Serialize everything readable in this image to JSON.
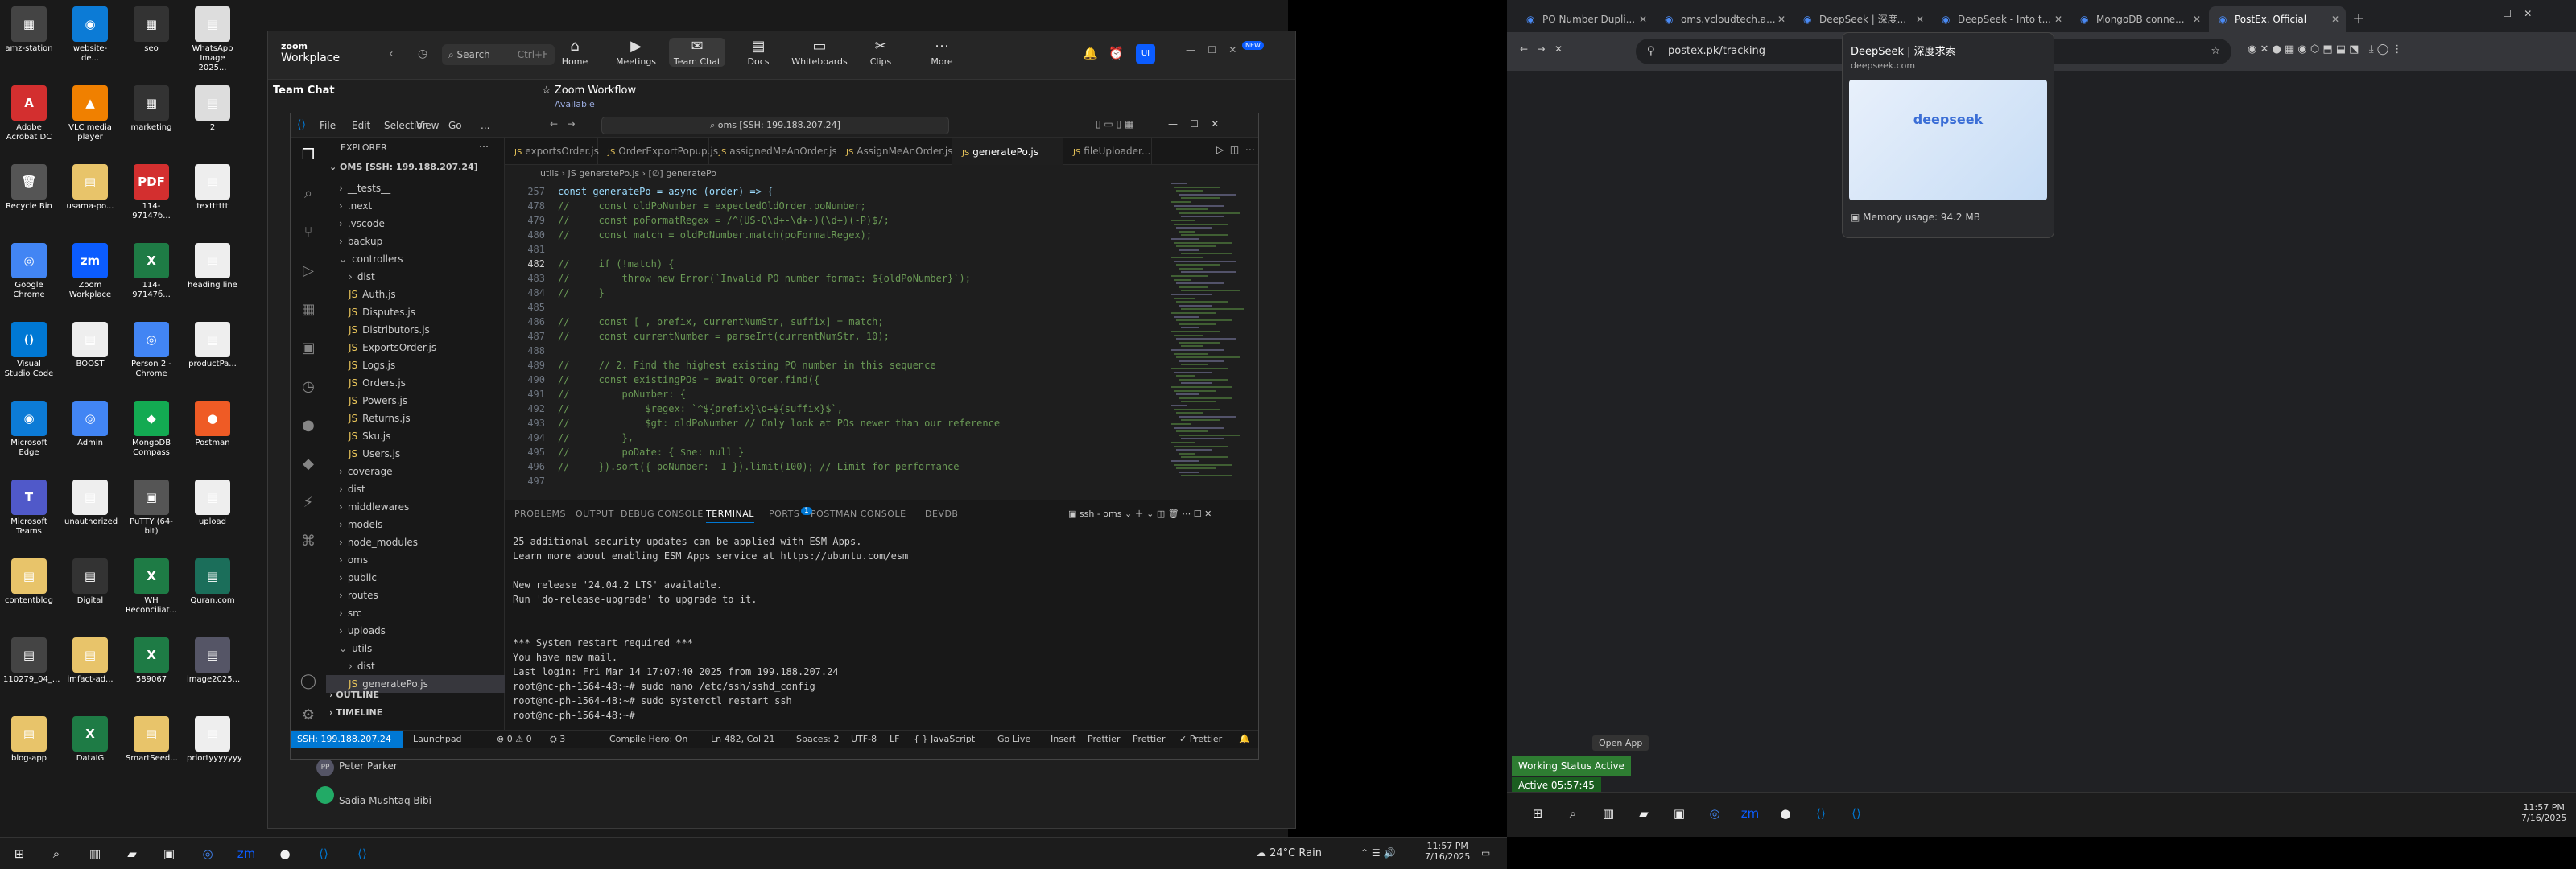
{
  "desktop": {
    "icons": [
      {
        "label": "amz-station",
        "g": "▦",
        "c": "#444"
      },
      {
        "label": "website-de...",
        "g": "◉",
        "c": "#0c7bd6"
      },
      {
        "label": "seo",
        "g": "▦",
        "c": "#333"
      },
      {
        "label": "WhatsApp Image 2025...",
        "g": "▤",
        "c": "#ddd"
      },
      {
        "label": "Adobe Acrobat DC",
        "g": "A",
        "c": "#d32f2f"
      },
      {
        "label": "VLC media player",
        "g": "▲",
        "c": "#f08000"
      },
      {
        "label": "marketing",
        "g": "▦",
        "c": "#333"
      },
      {
        "label": "2",
        "g": "▤",
        "c": "#ddd"
      },
      {
        "label": "Recycle Bin",
        "g": "🗑",
        "c": "#555"
      },
      {
        "label": "usama-po...",
        "g": "▤",
        "c": "#e8c46a"
      },
      {
        "label": "114-97147б...",
        "g": "PDF",
        "c": "#d32f2f"
      },
      {
        "label": "textttttt",
        "g": "▤",
        "c": "#eee"
      },
      {
        "label": "Google Chrome",
        "g": "◎",
        "c": "#4285f4"
      },
      {
        "label": "Zoom Workplace",
        "g": "zm",
        "c": "#0b5cff"
      },
      {
        "label": "114-97147б...",
        "g": "X",
        "c": "#1e7b45"
      },
      {
        "label": "heading line",
        "g": "▤",
        "c": "#eee"
      },
      {
        "label": "Visual Studio Code",
        "g": "⟨⟩",
        "c": "#0078d4"
      },
      {
        "label": "BOOST",
        "g": "▤",
        "c": "#eee"
      },
      {
        "label": "Person 2 - Chrome",
        "g": "◎",
        "c": "#4285f4"
      },
      {
        "label": "productPa...",
        "g": "▤",
        "c": "#eee"
      },
      {
        "label": "Microsoft Edge",
        "g": "◉",
        "c": "#0c7bd6"
      },
      {
        "label": "Admin",
        "g": "◎",
        "c": "#4285f4"
      },
      {
        "label": "MongoDB Compass",
        "g": "◆",
        "c": "#13aa52"
      },
      {
        "label": "Postman",
        "g": "●",
        "c": "#ef5b25"
      },
      {
        "label": "Microsoft Teams",
        "g": "T",
        "c": "#5059c9"
      },
      {
        "label": "unauthorized",
        "g": "▤",
        "c": "#eee"
      },
      {
        "label": "PuTTY (64-bit)",
        "g": "▣",
        "c": "#555"
      },
      {
        "label": "upload",
        "g": "▤",
        "c": "#eee"
      },
      {
        "label": "contentblog",
        "g": "▤",
        "c": "#e8c46a"
      },
      {
        "label": "Digital",
        "g": "▤",
        "c": "#333"
      },
      {
        "label": "WH Reconciliat...",
        "g": "X",
        "c": "#1e7b45"
      },
      {
        "label": "Quran.com",
        "g": "▤",
        "c": "#1b6e5a"
      },
      {
        "label": "110279_04_...",
        "g": "▤",
        "c": "#444"
      },
      {
        "label": "imfact-ad...",
        "g": "▤",
        "c": "#e8c46a"
      },
      {
        "label": "589067",
        "g": "X",
        "c": "#1e7b45"
      },
      {
        "label": "image2025...",
        "g": "▤",
        "c": "#556"
      },
      {
        "label": "blog-app",
        "g": "▤",
        "c": "#e8c46a"
      },
      {
        "label": "DataIG",
        "g": "X",
        "c": "#1e7b45"
      },
      {
        "label": "SmartSeed...",
        "g": "▤",
        "c": "#e8c46a"
      },
      {
        "label": "priortyyyyyyy",
        "g": "▤",
        "c": "#eee"
      }
    ]
  },
  "zoom": {
    "brand": "zoom",
    "brand2": "Workplace",
    "search": "Search",
    "shortcut": "Ctrl+F",
    "nav": [
      {
        "g": "⌂",
        "l": "Home"
      },
      {
        "g": "▶",
        "l": "Meetings"
      },
      {
        "g": "✉",
        "l": "Team Chat"
      },
      {
        "g": "▤",
        "l": "Docs"
      },
      {
        "g": "▭",
        "l": "Whiteboards"
      },
      {
        "g": "✂",
        "l": "Clips"
      },
      {
        "g": "⋯",
        "l": "More"
      }
    ],
    "badge": "NEW",
    "team_chat": "Team Chat",
    "workflow": "Zoom Workflow",
    "available": "Available",
    "contacts": [
      "Peter Parker",
      "Sadia Mushtaq Bibi"
    ]
  },
  "vscode": {
    "menu": [
      "File",
      "Edit",
      "Selection",
      "View",
      "Go",
      "..."
    ],
    "search": "oms [SSH: 199.188.207.24]",
    "explorer": "EXPLORER",
    "root": "OMS [SSH: 199.188.207.24]",
    "tree": [
      {
        "t": "__tests__",
        "d": 1,
        "f": 0
      },
      {
        "t": ".next",
        "d": 1,
        "f": 0
      },
      {
        "t": ".vscode",
        "d": 1,
        "f": 0
      },
      {
        "t": "backup",
        "d": 1,
        "f": 0
      },
      {
        "t": "controllers",
        "d": 1,
        "f": 0,
        "o": 1
      },
      {
        "t": "dist",
        "d": 2,
        "f": 0
      },
      {
        "t": "Auth.js",
        "d": 2,
        "f": 1
      },
      {
        "t": "Disputes.js",
        "d": 2,
        "f": 1
      },
      {
        "t": "Distributors.js",
        "d": 2,
        "f": 1
      },
      {
        "t": "ExportsOrder.js",
        "d": 2,
        "f": 1
      },
      {
        "t": "Logs.js",
        "d": 2,
        "f": 1
      },
      {
        "t": "Orders.js",
        "d": 2,
        "f": 1
      },
      {
        "t": "Powers.js",
        "d": 2,
        "f": 1
      },
      {
        "t": "Returns.js",
        "d": 2,
        "f": 1
      },
      {
        "t": "Sku.js",
        "d": 2,
        "f": 1
      },
      {
        "t": "Users.js",
        "d": 2,
        "f": 1
      },
      {
        "t": "coverage",
        "d": 1,
        "f": 0
      },
      {
        "t": "dist",
        "d": 1,
        "f": 0
      },
      {
        "t": "middlewares",
        "d": 1,
        "f": 0
      },
      {
        "t": "models",
        "d": 1,
        "f": 0
      },
      {
        "t": "node_modules",
        "d": 1,
        "f": 0
      },
      {
        "t": "oms",
        "d": 1,
        "f": 0
      },
      {
        "t": "public",
        "d": 1,
        "f": 0
      },
      {
        "t": "routes",
        "d": 1,
        "f": 0
      },
      {
        "t": "src",
        "d": 1,
        "f": 0
      },
      {
        "t": "uploads",
        "d": 1,
        "f": 0
      },
      {
        "t": "utils",
        "d": 1,
        "f": 0,
        "o": 1
      },
      {
        "t": "dist",
        "d": 2,
        "f": 0
      },
      {
        "t": "generatePo.js",
        "d": 2,
        "f": 1,
        "s": 1
      }
    ],
    "outline": "OUTLINE",
    "timeline": "TIMELINE",
    "tabs": [
      "exportsOrder.js",
      "OrderExportPopup.js",
      "assignedMeAnOrder.js",
      "AssignMeAnOrder.js",
      "generatePo.js",
      "fileUploader..."
    ],
    "breadcrumb": "utils  ›  JS generatePo.js  ›  [∅] generatePo",
    "lines": [
      {
        "n": "257",
        "c": "const generatePo = async (order) => {",
        "k": 1
      },
      {
        "n": "478",
        "c": "//     const oldPoNumber = expectedOldOrder.poNumber;"
      },
      {
        "n": "479",
        "c": "//     const poFormatRegex = /^(US-Q\\d+-\\d+-)(\\d+)(-P)$/;"
      },
      {
        "n": "480",
        "c": "//     const match = oldPoNumber.match(poFormatRegex);"
      },
      {
        "n": "481",
        "c": ""
      },
      {
        "n": "482",
        "c": "//     if (!match) {"
      },
      {
        "n": "483",
        "c": "//         throw new Error(`Invalid PO number format: ${oldPoNumber}`);"
      },
      {
        "n": "484",
        "c": "//     }"
      },
      {
        "n": "485",
        "c": ""
      },
      {
        "n": "486",
        "c": "//     const [_, prefix, currentNumStr, suffix] = match;"
      },
      {
        "n": "487",
        "c": "//     const currentNumber = parseInt(currentNumStr, 10);"
      },
      {
        "n": "488",
        "c": ""
      },
      {
        "n": "489",
        "c": "//     // 2. Find the highest existing PO number in this sequence"
      },
      {
        "n": "490",
        "c": "//     const existingPOs = await Order.find({"
      },
      {
        "n": "491",
        "c": "//         poNumber: {"
      },
      {
        "n": "492",
        "c": "//             $regex: `^${prefix}\\d+${suffix}$`,"
      },
      {
        "n": "493",
        "c": "//             $gt: oldPoNumber // Only look at POs newer than our reference"
      },
      {
        "n": "494",
        "c": "//         },"
      },
      {
        "n": "495",
        "c": "//         poDate: { $ne: null }"
      },
      {
        "n": "496",
        "c": "//     }).sort({ poNumber: -1 }).limit(100); // Limit for performance"
      },
      {
        "n": "497",
        "c": ""
      }
    ],
    "panel_tabs": [
      "PROBLEMS",
      "OUTPUT",
      "DEBUG CONSOLE",
      "TERMINAL",
      "PORTS",
      "POSTMAN CONSOLE",
      "DEVDB"
    ],
    "ports_badge": "1",
    "term_label": "ssh - oms",
    "terminal": "25 additional security updates can be applied with ESM Apps.\nLearn more about enabling ESM Apps service at https://ubuntu.com/esm\n\nNew release '24.04.2 LTS' available.\nRun 'do-release-upgrade' to upgrade to it.\n\n\n*** System restart required ***\nYou have new mail.\nLast login: Fri Mar 14 17:07:40 2025 from 199.188.207.24\nroot@nc-ph-1564-48:~# sudo nano /etc/ssh/sshd_config\nroot@nc-ph-1564-48:~# sudo systemctl restart ssh\nroot@nc-ph-1564-48:~# ",
    "status": {
      "remote": "SSH: 199.188.207.24",
      "launchpad": "Launchpad",
      "problems": "⊗ 0 ⚠ 0",
      "ports": "⛭ 3",
      "compile": "Compile Hero: On",
      "pos": "Ln 482, Col 21",
      "spaces": "Spaces: 2",
      "enc": "UTF-8",
      "eol": "LF",
      "lang": "{ } JavaScript",
      "golive": "Go Live",
      "insert": "Insert",
      "prettier": "Prettier",
      "prettier2": "Prettier",
      "prettier3": "✓ Prettier"
    }
  },
  "chrome": {
    "tabs": [
      "PO Number Dupli...",
      "oms.vcloudtech.a...",
      "DeepSeek | 深度...",
      "DeepSeek - Into t...",
      "MongoDB conne...",
      "PostEx. Official"
    ],
    "active": 5,
    "url": "postex.pk/tracking",
    "popup": {
      "title": "DeepSeek | 深度求索",
      "domain": "deepseek.com",
      "thumb": "deepseek",
      "memory": "Memory usage: 94.2 MB"
    },
    "open_app": "Open App",
    "working": "Working Status Active",
    "active_time": "Active 05:57:45",
    "time": "11:57 PM",
    "date": "7/16/2025"
  },
  "taskbar": {
    "weather": "24°C  Rain",
    "time": "11:57 PM",
    "date": "7/16/2025"
  }
}
